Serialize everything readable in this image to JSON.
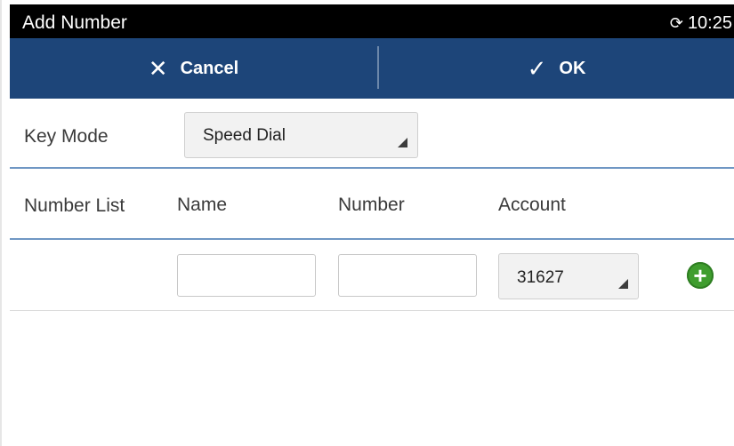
{
  "status_bar": {
    "title": "Add Number",
    "sync_icon": "sync-icon",
    "time": "10:25"
  },
  "action_bar": {
    "cancel_label": "Cancel",
    "cancel_icon": "close-icon",
    "ok_label": "OK",
    "ok_icon": "check-icon",
    "background": "#1d4579"
  },
  "key_mode": {
    "label": "Key Mode",
    "value": "Speed Dial"
  },
  "number_list": {
    "label": "Number List",
    "columns": [
      "Name",
      "Number",
      "Account"
    ],
    "row": {
      "name_value": "",
      "number_value": "",
      "account_value": "31627",
      "add_icon": "add-circle-icon",
      "add_color": "#3f9d2e"
    }
  }
}
